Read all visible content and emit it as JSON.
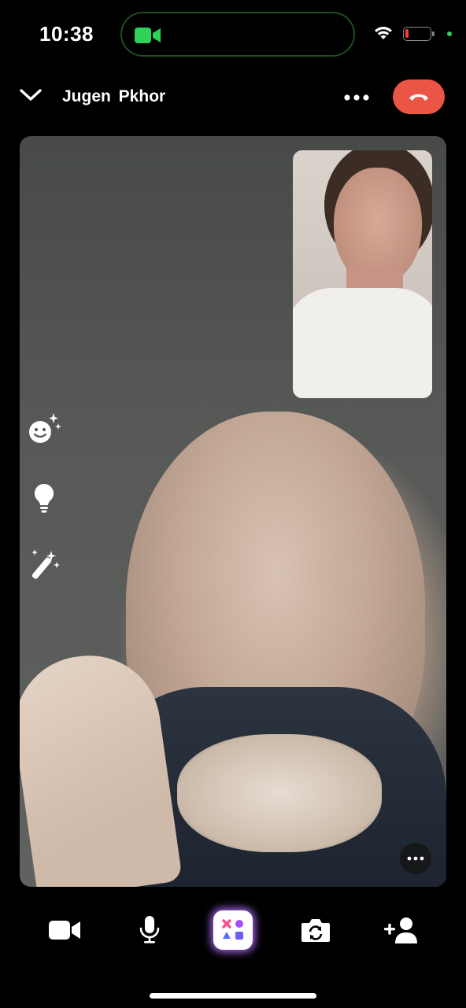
{
  "status_bar": {
    "time": "10:38",
    "icons": [
      "video-call-active-icon",
      "wifi-icon",
      "battery-icon",
      "privacy-dot"
    ],
    "accent_green": "#30d158",
    "battery_color": "#ff3b30"
  },
  "header": {
    "caller_name": "Jugen  Pkhor",
    "end_call_color": "#eb5545"
  },
  "side_tools": [
    "smiley-sparkle-icon",
    "lightbulb-icon",
    "magic-wand-icon"
  ],
  "bottom_bar": [
    "video-camera-icon",
    "microphone-icon",
    "effects-icon",
    "flip-camera-icon",
    "add-person-icon"
  ]
}
